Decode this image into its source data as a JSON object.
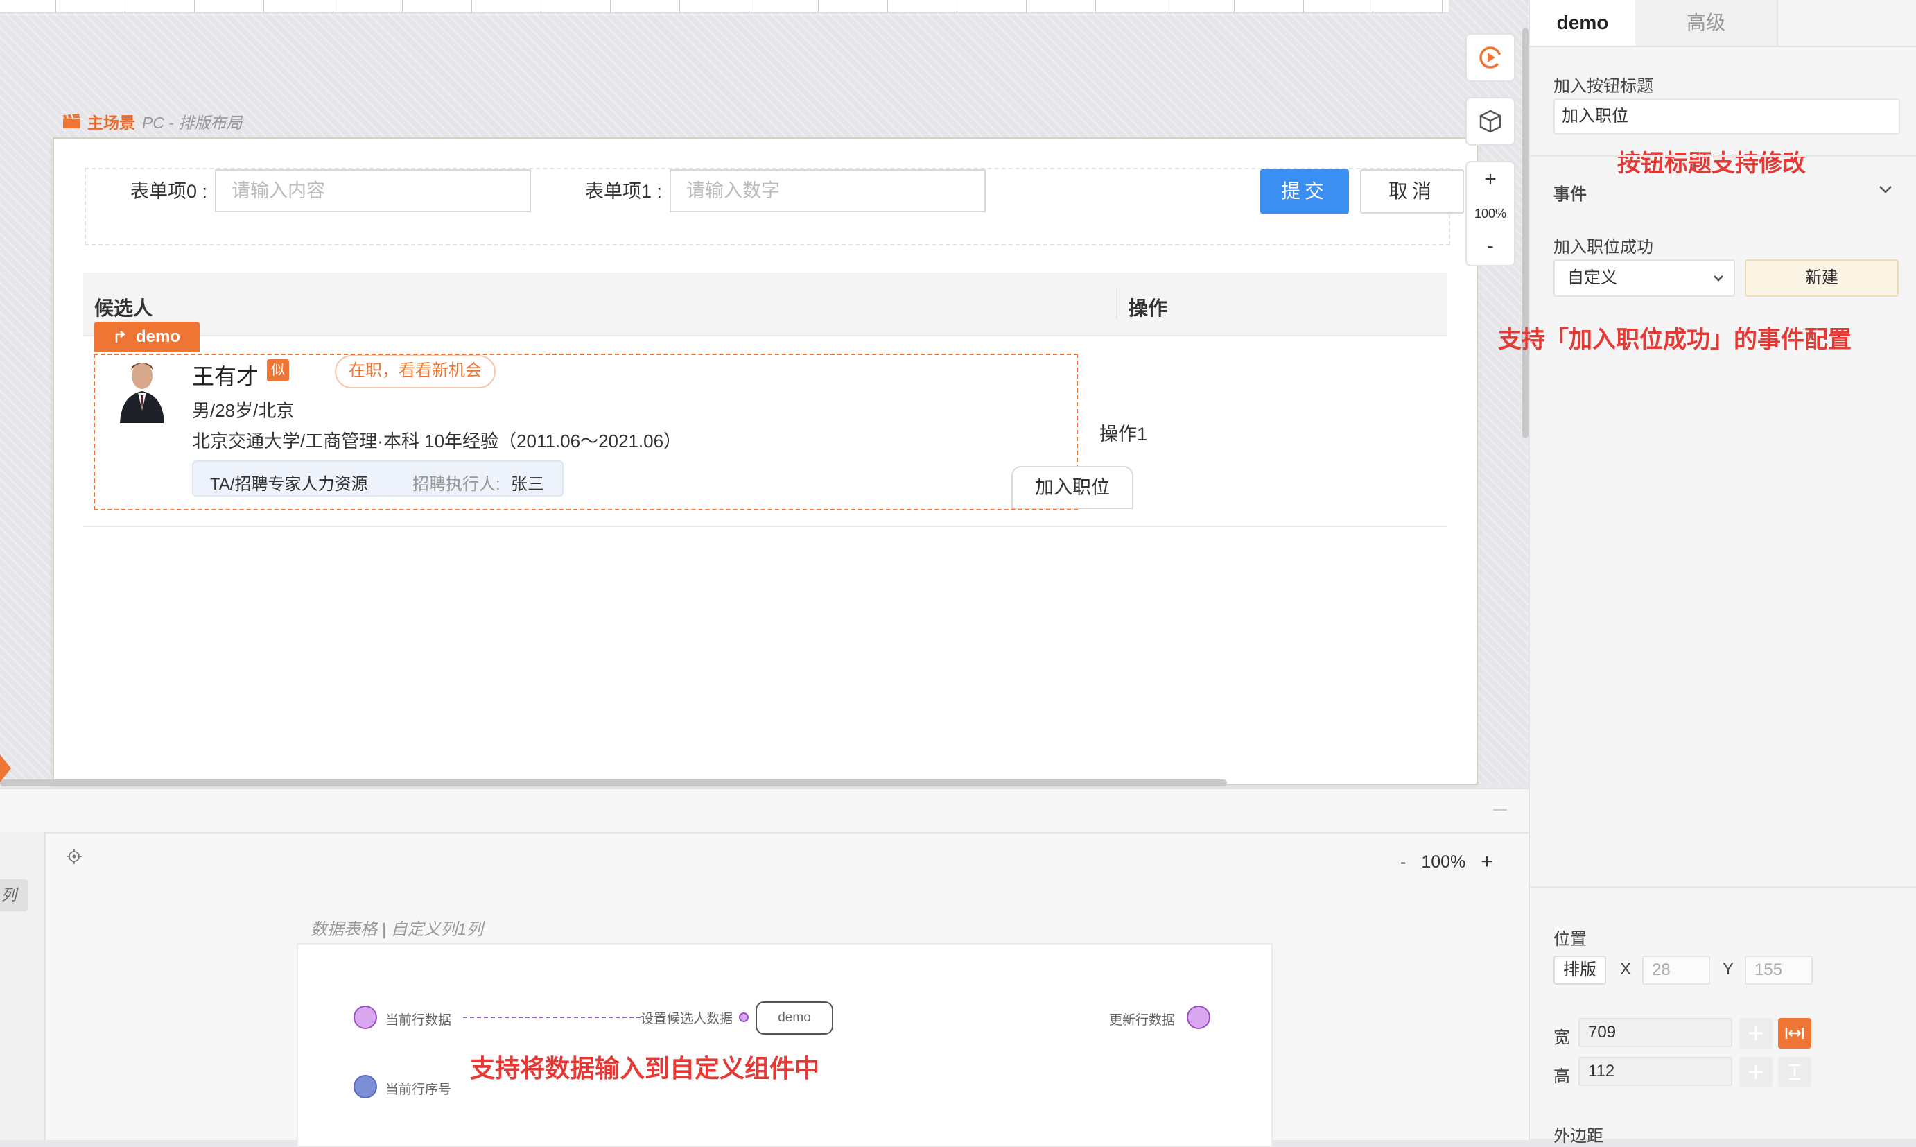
{
  "canvas": {
    "scene_main": "主场景",
    "scene_sub": "PC - 排版布局",
    "zoom_percent": "100%",
    "zoom_in": "+",
    "zoom_out": "-"
  },
  "form": {
    "field0_label": "表单项0 :",
    "field0_placeholder": "请输入内容",
    "field1_label": "表单项1 :",
    "field1_placeholder": "请输入数字",
    "submit_label": "提交",
    "cancel_label": "取消"
  },
  "table": {
    "col_candidate": "候选人",
    "col_operation": "操作",
    "component_tag": "demo",
    "row": {
      "name": "王有才",
      "badge": "似",
      "status": "在职，看看新机会",
      "info": "男/28岁/北京",
      "education": "北京交通大学/工商管理·本科  10年经验（2011.06～2021.06）",
      "tag_title": "TA/招聘专家人力资源",
      "tag_recruiter_label": "招聘执行人:",
      "tag_recruiter": "张三",
      "join_button": "加入职位",
      "operation": "操作1"
    }
  },
  "bottom": {
    "zoom_out": "-",
    "zoom_level": "100%",
    "zoom_in": "+",
    "left_chip": "列",
    "caption": "数据表格 | 自定义列1列",
    "ports": {
      "current_row_data": "当前行数据",
      "set_candidate_data": "设置候选人数据",
      "demo_node": "demo",
      "update_row_data": "更新行数据",
      "current_row_index": "当前行序号"
    },
    "annotation": "支持将数据输入到自定义组件中"
  },
  "right_panel": {
    "tab_demo": "demo",
    "tab_advanced": "高级",
    "button_title_label": "加入按钮标题",
    "button_title_value": "加入职位",
    "annotation_title": "按钮标题支持修改",
    "events_label": "事件",
    "event_success_label": "加入职位成功",
    "event_select_value": "自定义",
    "new_button": "新建",
    "annotation_event": "支持「加入职位成功」的事件配置",
    "position_label": "位置",
    "layout_button": "排版",
    "x_label": "X",
    "x_value": "28",
    "y_label": "Y",
    "y_value": "155",
    "width_label": "宽",
    "width_value": "709",
    "height_label": "高",
    "height_value": "112",
    "margin_label": "外边距"
  },
  "colors": {
    "accent_orange": "#ee7534",
    "primary_blue": "#3b8ff0",
    "annotation_red": "#e53935",
    "port_purple": "#d9a6f0",
    "port_blue": "#7b8fd6"
  }
}
